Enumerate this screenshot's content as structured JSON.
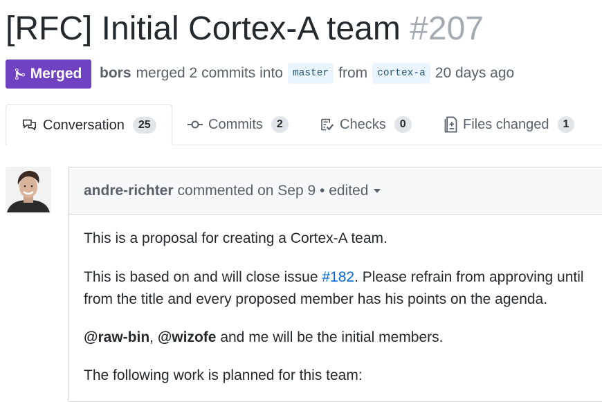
{
  "pr": {
    "title": "[RFC] Initial Cortex-A team",
    "number": "#207",
    "state_label": "Merged",
    "state_color": "#6f42c1",
    "author": "bors",
    "action_text": "merged 2 commits into",
    "base_branch": "master",
    "from_text": "from",
    "head_branch": "cortex-a",
    "time": "20 days ago"
  },
  "tabs": [
    {
      "label": "Conversation",
      "count": "25",
      "icon": "comment-discussion-icon",
      "selected": true
    },
    {
      "label": "Commits",
      "count": "2",
      "icon": "git-commit-icon",
      "selected": false
    },
    {
      "label": "Checks",
      "count": "0",
      "icon": "checklist-icon",
      "selected": false
    },
    {
      "label": "Files changed",
      "count": "1",
      "icon": "file-diff-icon",
      "selected": false
    }
  ],
  "comment": {
    "author": "andre-richter",
    "meta": "commented on Sep 9 • edited",
    "p1": "This is a proposal for creating a Cortex-A team.",
    "p2_pre": "This is based on and will close issue ",
    "p2_link": "#182",
    "p2_post": ". Please refrain from approving until",
    "p2_line2": "from the title and every proposed member has his points on the agenda.",
    "mention1": "@raw-bin",
    "sep": ", ",
    "mention2": "@wizofe",
    "p3_post": " and me will be the initial members.",
    "p4": "The following work is planned for this team:"
  }
}
